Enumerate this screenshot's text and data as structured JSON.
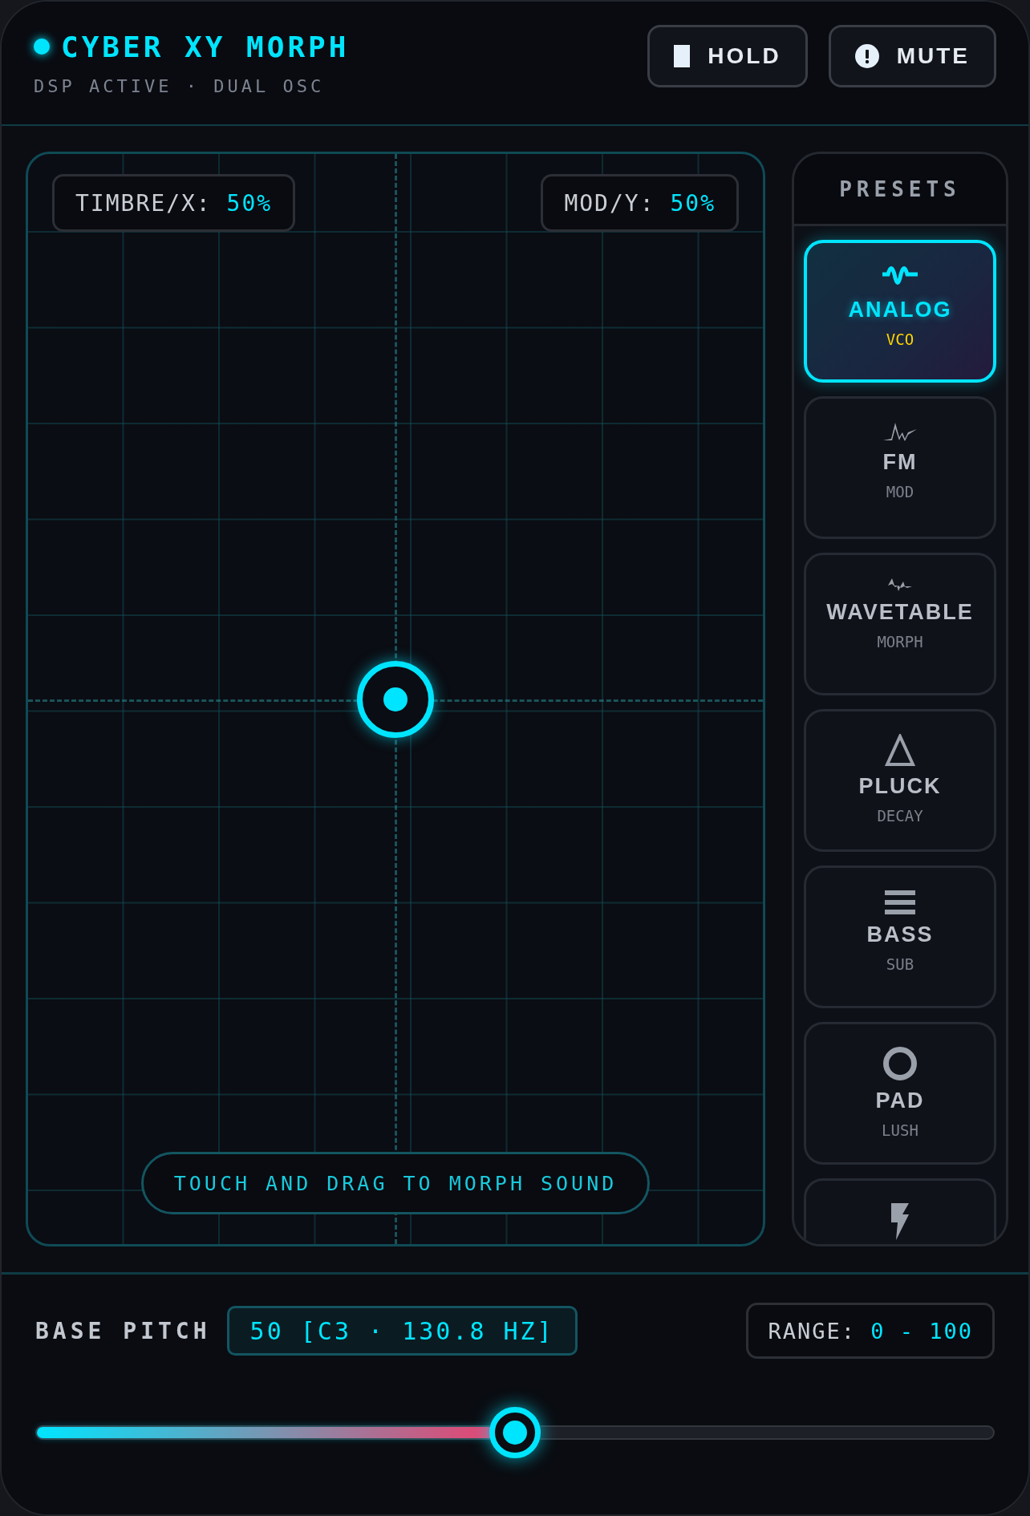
{
  "header": {
    "title": "CYBER XY MORPH",
    "subtitle": "DSP ACTIVE · DUAL OSC",
    "live": true,
    "buttons": [
      {
        "kind": "hold",
        "label": "HOLD"
      },
      {
        "kind": "mute",
        "label": "MUTE"
      }
    ]
  },
  "pad": {
    "axes": [
      {
        "label": "TIMBRE/X:",
        "value": "50%",
        "level": 0.5
      },
      {
        "label": "MOD/Y:",
        "value": "50%",
        "level": 0.5
      }
    ],
    "hint": "TOUCH AND DRAG TO MORPH SOUND"
  },
  "presets": {
    "title": "PRESETS",
    "items": [
      {
        "kind": "sine",
        "name": "ANALOG",
        "sub": "VCO",
        "selected": true
      },
      {
        "kind": "fm",
        "name": "FM",
        "sub": "MOD",
        "selected": false
      },
      {
        "kind": "wavetable",
        "name": "WAVETABLE",
        "sub": "MORPH",
        "selected": false
      },
      {
        "kind": "triangle",
        "name": "PLUCK",
        "sub": "DECAY",
        "selected": false
      },
      {
        "kind": "bars",
        "name": "BASS",
        "sub": "SUB",
        "selected": false
      },
      {
        "kind": "circle",
        "name": "PAD",
        "sub": "LUSH",
        "selected": false
      },
      {
        "kind": "bolt",
        "selected": false
      }
    ]
  },
  "pitch": {
    "label": "BASE PITCH",
    "value": "50 [C3 · 130.8 HZ]",
    "range_label": "RANGE:",
    "range_value": "0 - 100",
    "level": 0.5
  }
}
